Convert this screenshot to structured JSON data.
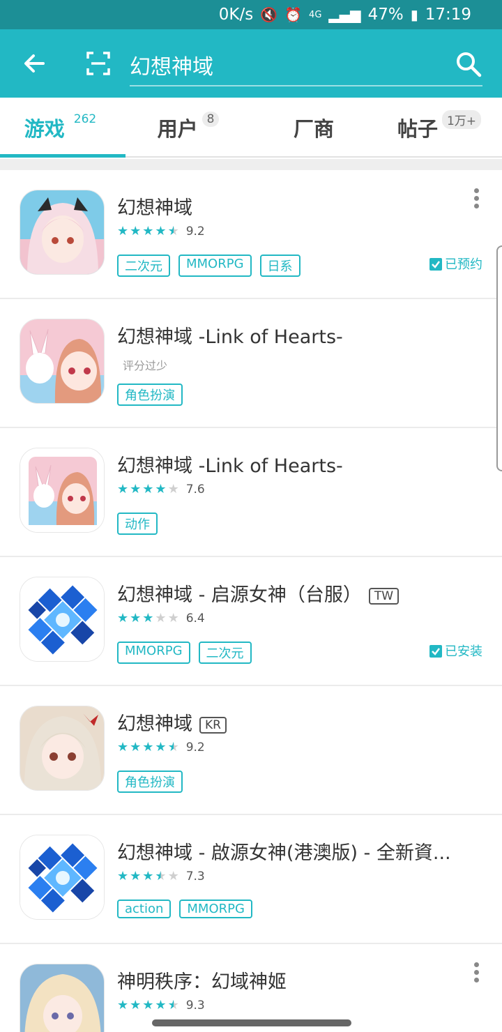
{
  "status_bar": {
    "speed": "0K/s",
    "network": "4G",
    "battery": "47%",
    "time": "17:19"
  },
  "search": {
    "query": "幻想神域",
    "placeholder": ""
  },
  "tabs": [
    {
      "label": "游戏",
      "badge": "262",
      "active": true
    },
    {
      "label": "用户",
      "badge": "8",
      "active": false
    },
    {
      "label": "厂商",
      "badge": "",
      "active": false
    },
    {
      "label": "帖子",
      "badge": "1万+",
      "active": false
    }
  ],
  "colors": {
    "accent": "#22b8c4",
    "status_bar": "#1c8f96"
  },
  "results": [
    {
      "name": "幻想神域",
      "region": "",
      "rating": 4.6,
      "score": "9.2",
      "rating_note": "",
      "tags": [
        "二次元",
        "MMORPG",
        "日系"
      ],
      "status": "已预约",
      "more": true
    },
    {
      "name": "幻想神域 -Link of Hearts-",
      "region": "",
      "rating": 0,
      "score": "",
      "rating_note": "评分过少",
      "tags": [
        "角色扮演"
      ],
      "status": "",
      "more": false
    },
    {
      "name": "幻想神域 -Link of Hearts-",
      "region": "",
      "rating": 3.8,
      "score": "7.6",
      "rating_note": "",
      "tags": [
        "动作"
      ],
      "status": "",
      "more": false
    },
    {
      "name": "幻想神域 - 启源女神（台服）",
      "region": "TW",
      "rating": 3.2,
      "score": "6.4",
      "rating_note": "",
      "tags": [
        "MMORPG",
        "二次元"
      ],
      "status": "已安装",
      "more": false
    },
    {
      "name": "幻想神域",
      "region": "KR",
      "rating": 4.6,
      "score": "9.2",
      "rating_note": "",
      "tags": [
        "角色扮演"
      ],
      "status": "",
      "more": false
    },
    {
      "name": "幻想神域 - 啟源女神(港澳版)  - 全新資...",
      "region": "",
      "rating": 3.7,
      "score": "7.3",
      "rating_note": "",
      "tags": [
        "action",
        "MMORPG"
      ],
      "status": "",
      "more": false
    },
    {
      "name": "神明秩序：幻域神姬",
      "region": "",
      "rating": 4.7,
      "score": "9.3",
      "rating_note": "",
      "tags": [],
      "status": "",
      "more": true
    }
  ]
}
